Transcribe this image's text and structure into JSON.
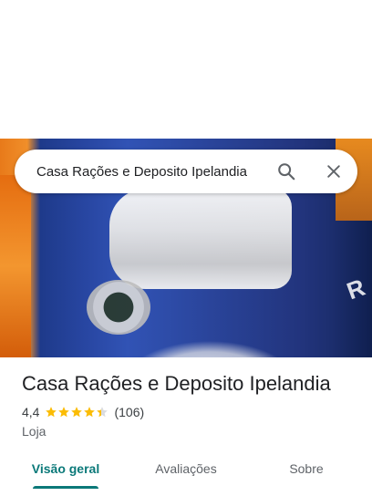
{
  "search": {
    "query": "Casa Rações e Deposito Ipelandia",
    "search_icon": "search-icon",
    "close_icon": "close-icon"
  },
  "place": {
    "title": "Casa Rações e Deposito Ipelandia",
    "rating": "4,4",
    "rating_value": 4.4,
    "review_count": "(106)",
    "category": "Loja",
    "star_color": "#fbbc04",
    "star_empty_color": "#dadce0"
  },
  "tabs": [
    {
      "label": "Visão geral",
      "active": true
    },
    {
      "label": "Avaliações",
      "active": false
    },
    {
      "label": "Sobre",
      "active": false
    }
  ],
  "colors": {
    "accent": "#0b7979"
  }
}
